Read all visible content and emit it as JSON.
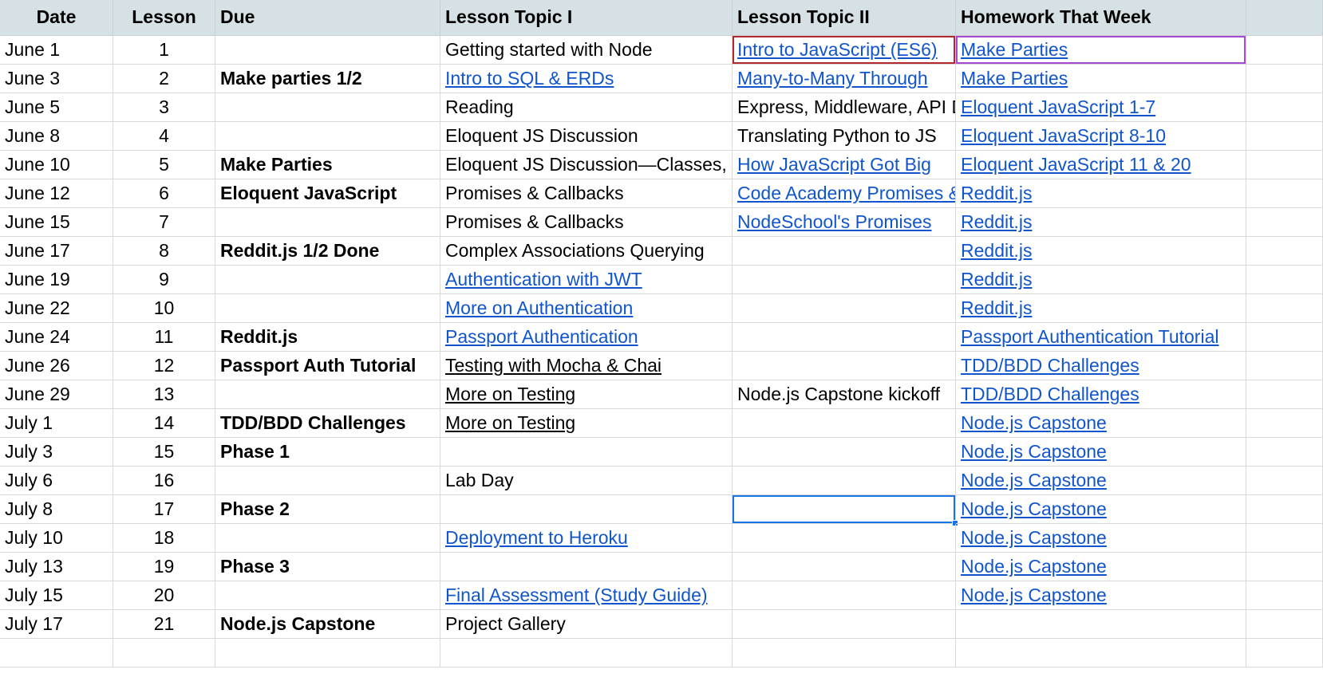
{
  "headers": [
    "Date",
    "Lesson",
    "Due",
    "Lesson Topic I",
    "Lesson Topic II",
    "Homework That Week"
  ],
  "rows": [
    {
      "date": "June 1",
      "lesson": "1",
      "due": "",
      "topic1": "Getting started with Node",
      "topic2": "Intro to JavaScript (ES6)",
      "homework": "Make Parties"
    },
    {
      "date": "June 3",
      "lesson": "2",
      "due": "Make parties 1/2",
      "topic1": "Intro to SQL & ERDs",
      "topic2": "Many-to-Many Through",
      "homework": "Make Parties"
    },
    {
      "date": "June 5",
      "lesson": "3",
      "due": "",
      "topic1": "Reading",
      "topic2": "Express, Middleware, API D",
      "homework": "Eloquent JavaScript 1-7"
    },
    {
      "date": "June 8",
      "lesson": "4",
      "due": "",
      "topic1": "Eloquent JS Discussion",
      "topic2": "Translating Python to JS",
      "homework": "Eloquent JavaScript 8-10"
    },
    {
      "date": "June 10",
      "lesson": "5",
      "due": "Make Parties",
      "topic1": "Eloquent JS Discussion—Classes, M",
      "topic2": "How JavaScript Got Big",
      "homework": "Eloquent JavaScript 11 & 20"
    },
    {
      "date": "June 12",
      "lesson": "6",
      "due": "Eloquent JavaScript",
      "topic1": "Promises & Callbacks",
      "topic2": "Code Academy Promises &",
      "homework": "Reddit.js"
    },
    {
      "date": "June 15",
      "lesson": "7",
      "due": "",
      "topic1": "Promises & Callbacks",
      "topic2": "NodeSchool's Promises",
      "homework": "Reddit.js"
    },
    {
      "date": "June 17",
      "lesson": "8",
      "due": "Reddit.js 1/2 Done",
      "topic1": "Complex Associations Querying",
      "topic2": "",
      "homework": "Reddit.js"
    },
    {
      "date": "June 19",
      "lesson": "9",
      "due": "",
      "topic1": "Authentication with JWT",
      "topic2": "",
      "homework": "Reddit.js"
    },
    {
      "date": "June 22",
      "lesson": "10",
      "due": "",
      "topic1": "More on Authentication",
      "topic2": "",
      "homework": "Reddit.js"
    },
    {
      "date": "June 24",
      "lesson": "11",
      "due": "Reddit.js",
      "topic1": "Passport Authentication",
      "topic2": "",
      "homework": "Passport Authentication Tutorial"
    },
    {
      "date": "June 26",
      "lesson": "12",
      "due": "Passport Auth Tutorial",
      "topic1": "Testing with Mocha & Chai",
      "topic2": "",
      "homework": "TDD/BDD Challenges"
    },
    {
      "date": "June 29",
      "lesson": "13",
      "due": "",
      "topic1": "More on Testing",
      "topic2": "Node.js Capstone kickoff",
      "homework": "TDD/BDD Challenges"
    },
    {
      "date": "July 1",
      "lesson": "14",
      "due": "TDD/BDD Challenges",
      "topic1": "More on Testing",
      "topic2": "",
      "homework": "Node.js Capstone"
    },
    {
      "date": "July 3",
      "lesson": "15",
      "due": "Phase 1",
      "topic1": "",
      "topic2": "",
      "homework": "Node.js Capstone"
    },
    {
      "date": "July 6",
      "lesson": "16",
      "due": "",
      "topic1": "Lab Day",
      "topic2": "",
      "homework": "Node.js Capstone"
    },
    {
      "date": "July 8",
      "lesson": "17",
      "due": "Phase 2",
      "topic1": "",
      "topic2": "",
      "homework": "Node.js Capstone"
    },
    {
      "date": "July 10",
      "lesson": "18",
      "due": "",
      "topic1": "Deployment to Heroku",
      "topic2": "",
      "homework": "Node.js Capstone"
    },
    {
      "date": "July 13",
      "lesson": "19",
      "due": "Phase 3",
      "topic1": "",
      "topic2": "",
      "homework": "Node.js Capstone"
    },
    {
      "date": "July 15",
      "lesson": "20",
      "due": "",
      "topic1": "Final Assessment (Study Guide)",
      "topic2": "",
      "homework": "Node.js Capstone"
    },
    {
      "date": "July 17",
      "lesson": "21",
      "due": "Node.js Capstone",
      "topic1": "Project Gallery",
      "topic2": "",
      "homework": ""
    },
    {
      "date": "",
      "lesson": "",
      "due": "",
      "topic1": "",
      "topic2": "",
      "homework": ""
    }
  ],
  "styles": {
    "link_color": "#1155cc",
    "header_bg": "#d6e1e5",
    "red_selection": "#b3292e",
    "purple_selection": "#a64bd1",
    "active_selection": "#1a73e8"
  },
  "links": {
    "topic1": [
      1,
      8,
      9,
      10,
      17,
      19
    ],
    "topic1_plain_underline": [
      11,
      12,
      13
    ],
    "topic2": [
      0,
      1,
      4,
      5,
      6
    ],
    "homework": [
      0,
      1,
      2,
      3,
      4,
      5,
      6,
      7,
      8,
      9,
      10,
      11,
      12,
      13,
      14,
      15,
      16,
      17,
      18,
      19
    ]
  },
  "selections": {
    "red": {
      "row": 0,
      "col": "topic2"
    },
    "purple": {
      "row": 0,
      "col": "homework"
    },
    "active": {
      "row": 16,
      "col": "topic2"
    }
  }
}
